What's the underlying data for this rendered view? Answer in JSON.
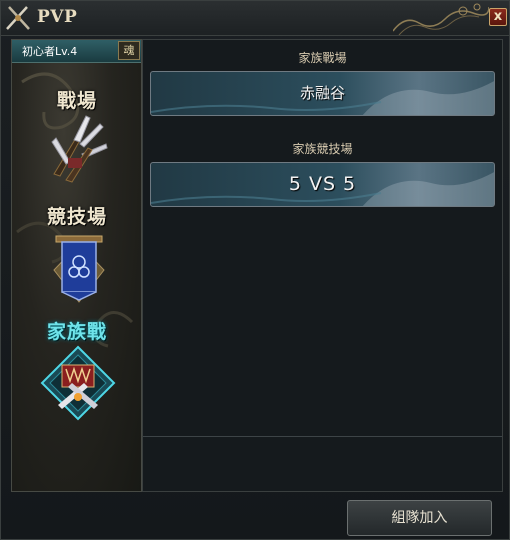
{
  "window": {
    "title": "PVP",
    "close_label": "x"
  },
  "player": {
    "label": "初心者Lv.4",
    "soul_badge": "魂"
  },
  "modes": [
    {
      "label": "戰場",
      "icon": "crossed-claws-icon",
      "active": false
    },
    {
      "label": "競技場",
      "icon": "banner-icon",
      "active": false
    },
    {
      "label": "家族戰",
      "icon": "clan-emblem-icon",
      "active": true
    }
  ],
  "sections": [
    {
      "title": "家族戰場",
      "entry": "赤融谷"
    },
    {
      "title": "家族競技場",
      "entry": "5  VS  5"
    }
  ],
  "footer": {
    "join_button": "組隊加入"
  },
  "colors": {
    "active_mode": "#6fe3ea",
    "mode_text": "#efe6cf",
    "close_button": "#8b2a1c",
    "entry_border": "#6f7a82"
  }
}
